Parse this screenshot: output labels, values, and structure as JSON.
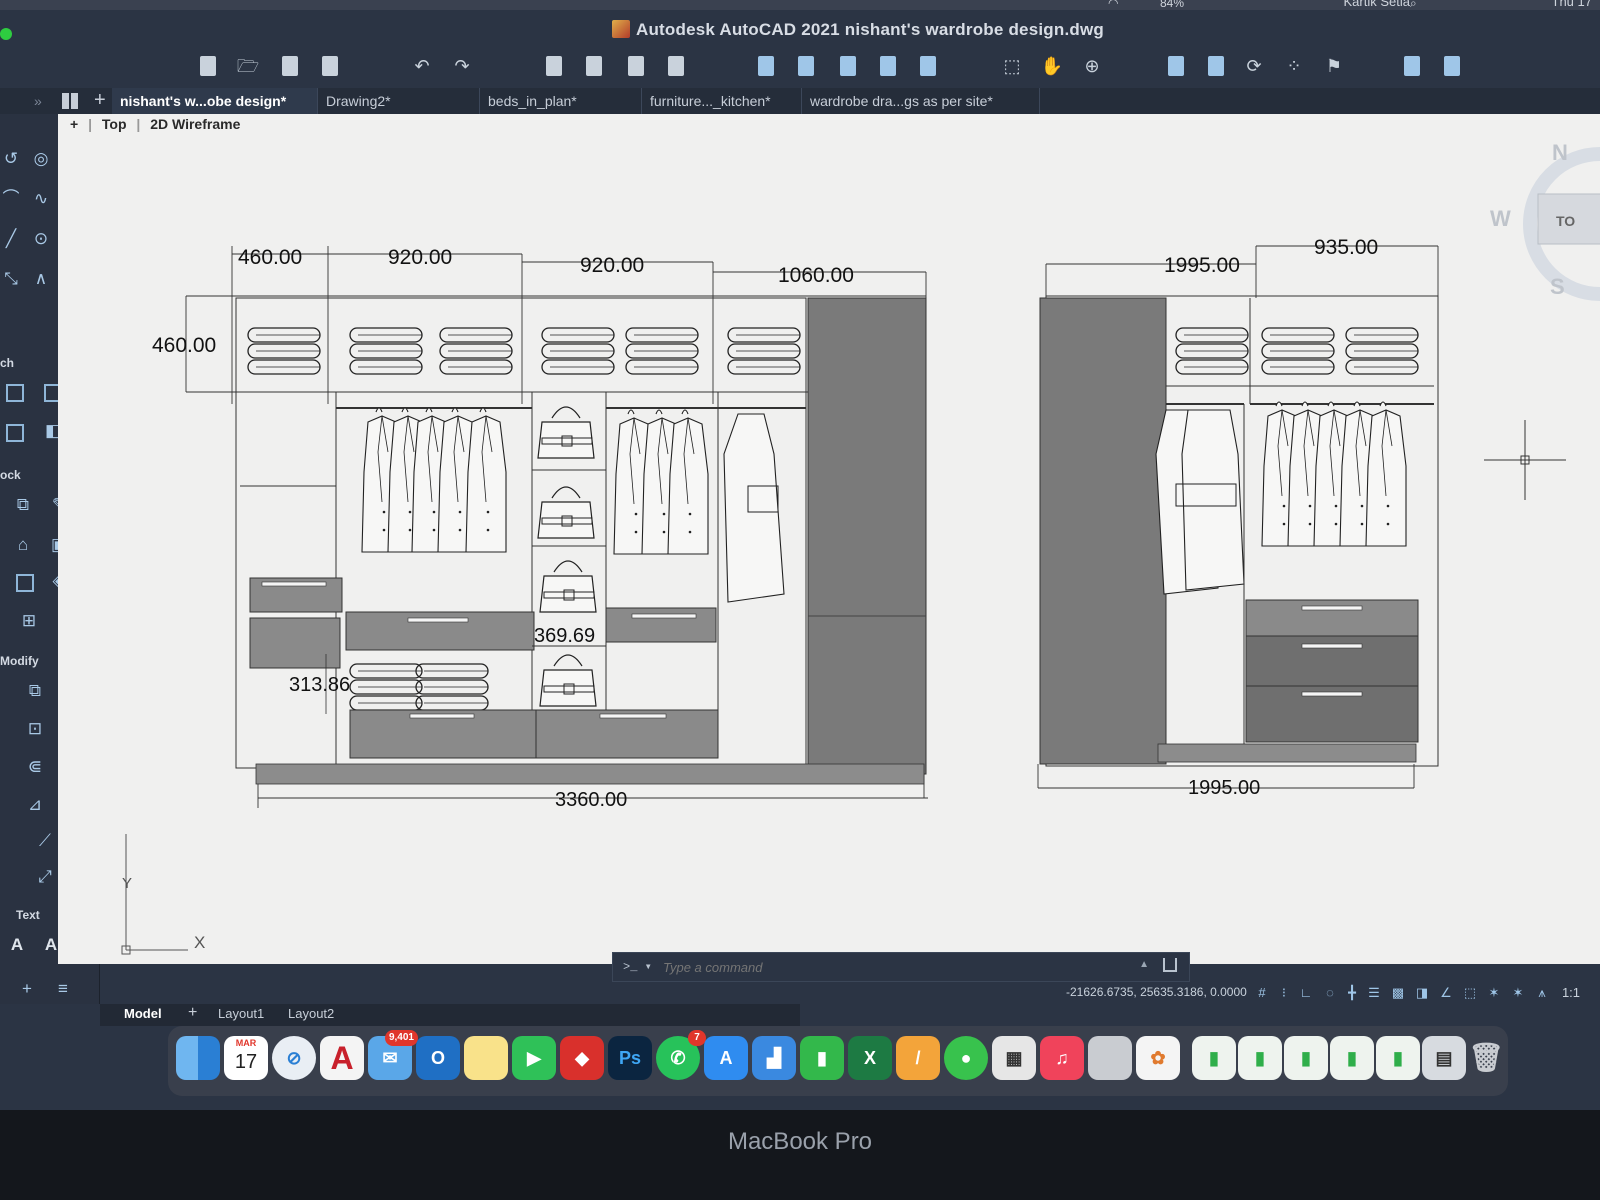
{
  "menubar": {
    "user": "Kartik Setia",
    "clock": "Thu 17",
    "battery": "84%"
  },
  "window": {
    "title": "Autodesk AutoCAD 2021   nishant's wardrobe design.dwg"
  },
  "tabs": [
    {
      "label": "nishant's w...obe design*",
      "active": true
    },
    {
      "label": "Drawing2*",
      "active": false
    },
    {
      "label": "beds_in_plan*",
      "active": false
    },
    {
      "label": "furniture..._kitchen*",
      "active": false
    },
    {
      "label": "wardrobe dra...gs as per site*",
      "active": false
    }
  ],
  "palette": {
    "sections": [
      "ch",
      "ock",
      "Modify",
      "Text"
    ]
  },
  "viewport": {
    "plus": "+",
    "view": "Top",
    "style": "2D Wireframe",
    "nav": {
      "north": "N",
      "west": "W",
      "south": "S",
      "cube_face": "TO"
    },
    "ucs": {
      "x": "X",
      "y": "Y"
    }
  },
  "drawing": {
    "left_elevation": {
      "dims_top": [
        "460.00",
        "920.00",
        "920.00",
        "1060.00"
      ],
      "dim_side": "460.00",
      "dim_inner_a": "313.86",
      "dim_inner_b": "369.69",
      "dim_bottom": "3360.00"
    },
    "right_elevation": {
      "dims_top": [
        "1995.00",
        "935.00"
      ],
      "dim_bottom": "1995.00"
    }
  },
  "command": {
    "prompt": ">_ ▾",
    "placeholder": "Type a command"
  },
  "status": {
    "coords": "-21626.6735, 25635.3186, 0.0000",
    "scale": "1:1"
  },
  "layouts": [
    {
      "label": "Model",
      "active": true
    },
    {
      "label": "+",
      "active": false
    },
    {
      "label": "Layout1",
      "active": false
    },
    {
      "label": "Layout2",
      "active": false
    }
  ],
  "dock": {
    "calendar_month": "MAR",
    "calendar_day": "17",
    "mail_badge": "9,401",
    "whatsapp_badge": "7",
    "ps_label": "Ps",
    "autocad_label": "A"
  },
  "bezel": {
    "brand": "MacBook Pro"
  },
  "colors": {
    "viewport_bg": "#f0f0ef",
    "ui_bg": "#2b3444",
    "panel_grey": "#7a7a7a",
    "accent_blue": "#9fc6e8"
  }
}
